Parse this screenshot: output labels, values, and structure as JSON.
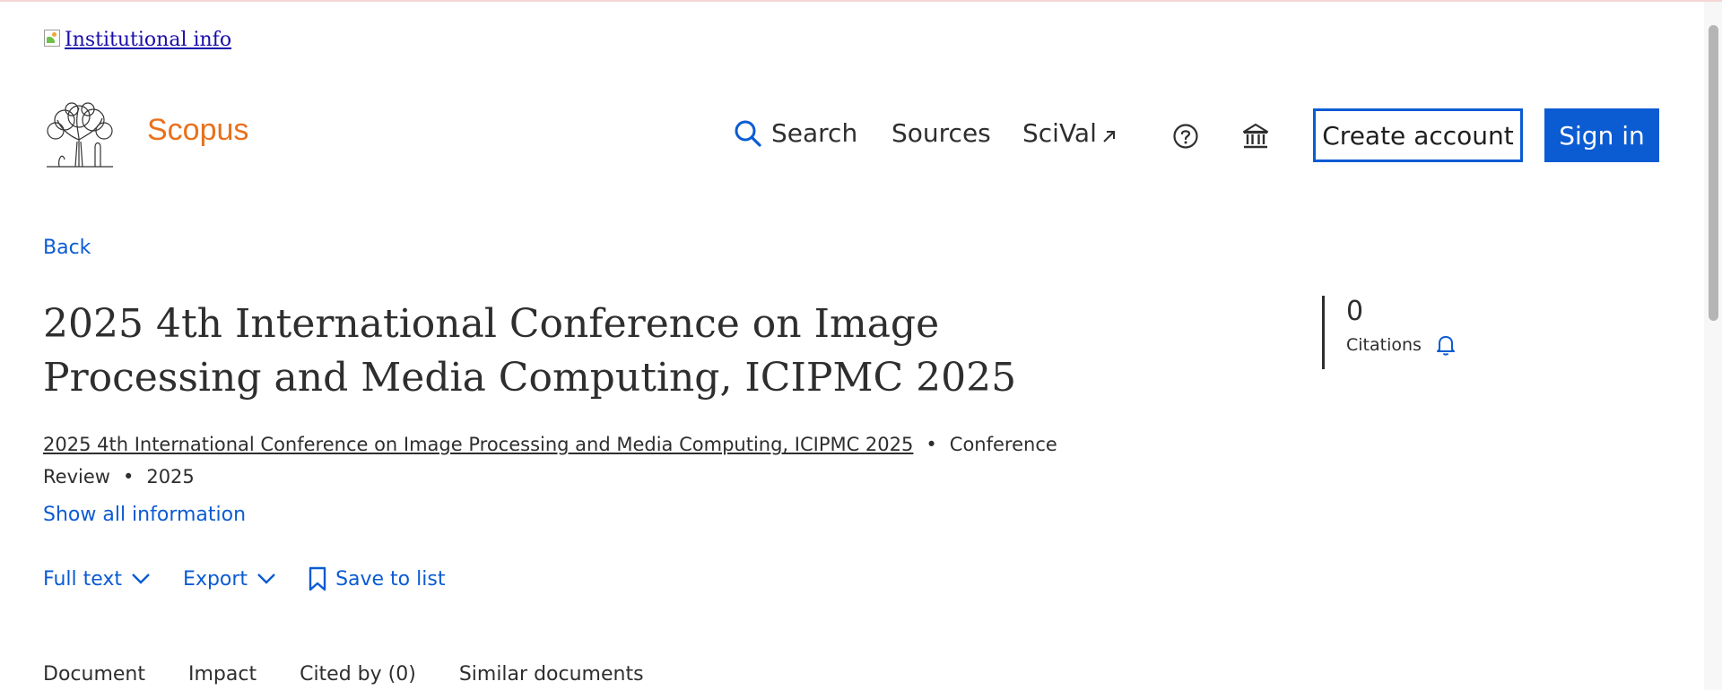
{
  "institution": {
    "alt_text": "Institutional info"
  },
  "header": {
    "brand": "Scopus",
    "nav": {
      "search": "Search",
      "sources": "Sources",
      "scival": "SciVal"
    },
    "buttons": {
      "create_account": "Create account",
      "sign_in": "Sign in"
    }
  },
  "document": {
    "back_label": "Back",
    "title": "2025 4th International Conference on Image Processing and Media Computing, ICIPMC 2025",
    "source_title": "2025 4th International Conference on Image Processing and Media Computing, ICIPMC 2025",
    "separator": "•",
    "doc_type": "Conference Review",
    "year": "2025",
    "show_all": "Show all information"
  },
  "actions": {
    "full_text": "Full text",
    "export": "Export",
    "save_to_list": "Save to list"
  },
  "metrics": {
    "citations_count": "0",
    "citations_label": "Citations"
  },
  "tabs": [
    {
      "label": "Document"
    },
    {
      "label": "Impact"
    },
    {
      "label": "Cited by (0)"
    },
    {
      "label": "Similar documents"
    }
  ],
  "colors": {
    "brand": "#e9711c",
    "link": "#0b5bd3",
    "text": "#2e2e2e"
  }
}
